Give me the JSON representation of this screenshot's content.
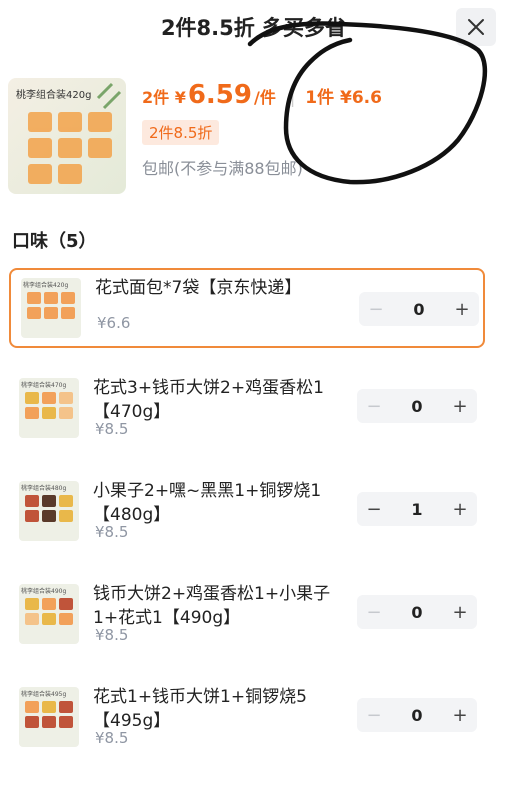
{
  "header": {
    "title": "2件8.5折 多买多省",
    "close_icon": "close-icon"
  },
  "summary": {
    "image_label": "桃李组合装420g",
    "price_prefix": "2件 ¥",
    "price_value": "6.59",
    "price_unit": "/件",
    "separator": "|",
    "original_price": "1件 ¥6.6",
    "discount_tag": "2件8.5折",
    "shipping": "包邮(不参与满88包邮)"
  },
  "section": {
    "title": "口味（5）"
  },
  "options": [
    {
      "thumb": "桃李组合装420g",
      "name": "花式面包*7袋【京东快递】",
      "price": "¥6.6",
      "qty": "0",
      "selected": true
    },
    {
      "thumb": "桃李组合装470g",
      "name": "花式3+钱币大饼2+鸡蛋香松1【470g】",
      "price": "¥8.5",
      "qty": "0",
      "selected": false
    },
    {
      "thumb": "桃李组合装480g",
      "name": "小果子2+嘿~黑黑1+铜锣烧1【480g】",
      "price": "¥8.5",
      "qty": "1",
      "selected": false
    },
    {
      "thumb": "桃李组合装490g",
      "name": "钱币大饼2+鸡蛋香松1+小果子1+花式1【490g】",
      "price": "¥8.5",
      "qty": "0",
      "selected": false
    },
    {
      "thumb": "桃李组合装495g",
      "name": "花式1+钱币大饼1+铜锣烧5【495g】",
      "price": "¥8.5",
      "qty": "0",
      "selected": false
    }
  ],
  "stepper": {
    "minus": "−",
    "plus": "+"
  },
  "colors": {
    "accent": "#f06a1a",
    "selected_border": "#f08a3a"
  }
}
